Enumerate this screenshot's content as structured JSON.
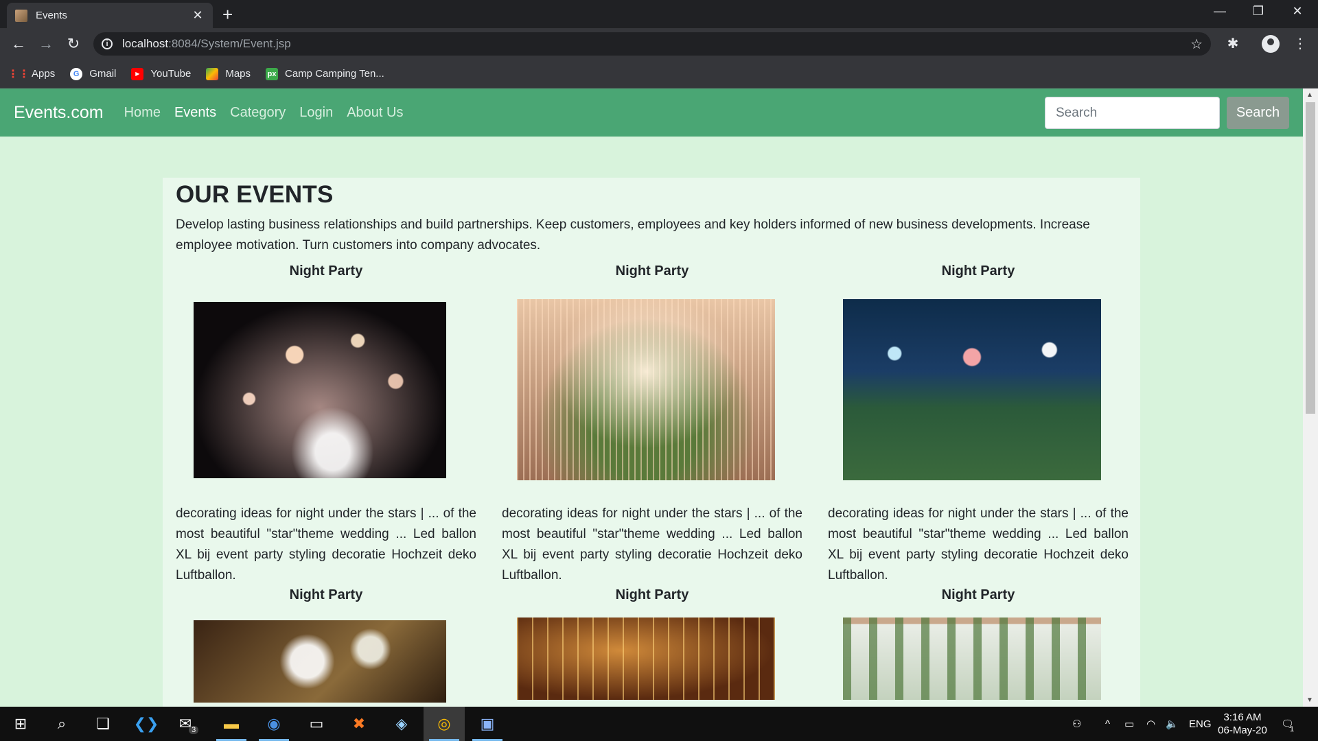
{
  "browser": {
    "tab_title": "Events",
    "url_host": "localhost",
    "url_rest": ":8084/System/Event.jsp",
    "bookmarks": [
      {
        "label": "Apps",
        "icon": "apps-grid-icon"
      },
      {
        "label": "Gmail",
        "icon": "google-icon"
      },
      {
        "label": "YouTube",
        "icon": "youtube-icon"
      },
      {
        "label": "Maps",
        "icon": "maps-icon"
      },
      {
        "label": "Camp Camping Ten...",
        "icon": "px-icon"
      }
    ]
  },
  "navbar": {
    "brand": "Events.com",
    "links": [
      "Home",
      "Events",
      "Category",
      "Login",
      "About Us"
    ],
    "active": "Events",
    "search_placeholder": "Search",
    "search_button": "Search"
  },
  "page": {
    "title": "OUR EVENTS",
    "intro": "Develop lasting business relationships and build partnerships. Keep customers, employees and key holders informed of new business developments. Increase employee motivation. Turn customers into company advocates."
  },
  "events": [
    {
      "title": "Night Party",
      "description": "decorating ideas for night under the stars | ... of the most beautiful \"star\"theme wedding ... Led ballon XL bij event party styling decoratie Hochzeit deko Luftballon."
    },
    {
      "title": "Night Party",
      "description": "decorating ideas for night under the stars | ... of the most beautiful \"star\"theme wedding ... Led ballon XL bij event party styling decoratie Hochzeit deko Luftballon."
    },
    {
      "title": "Night Party",
      "description": "decorating ideas for night under the stars | ... of the most beautiful \"star\"theme wedding ... Led ballon XL bij event party styling decoratie Hochzeit deko Luftballon."
    },
    {
      "title": "Night Party"
    },
    {
      "title": "Night Party"
    },
    {
      "title": "Night Party"
    }
  ],
  "taskbar": {
    "mail_badge": "3",
    "lang": "ENG",
    "time": "3:16 AM",
    "date": "06-May-20",
    "notification_count": "1"
  },
  "colors": {
    "navbar": "#4aa674",
    "page_bg": "#d8f3dc",
    "container_bg": "#e9f8ec",
    "search_button": "#8a9a90"
  }
}
